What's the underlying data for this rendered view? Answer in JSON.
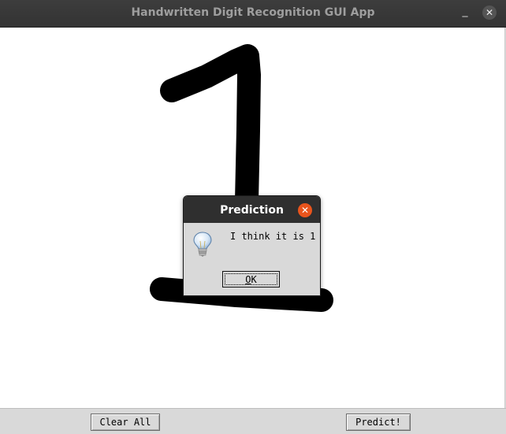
{
  "window": {
    "title": "Handwritten Digit Recognition GUI App",
    "minimize_glyph": "_",
    "close_glyph": "✕"
  },
  "canvas": {
    "stroke_color": "#000000",
    "background": "#ffffff"
  },
  "toolbar": {
    "clear_label": "Clear All",
    "predict_label": "Predict!"
  },
  "dialog": {
    "title": "Prediction",
    "close_glyph": "✕",
    "message": "I think it is 1",
    "ok_mnemonic": "O",
    "ok_rest": "K",
    "icon": "lightbulb-info-icon",
    "close_color": "#e9541c"
  }
}
